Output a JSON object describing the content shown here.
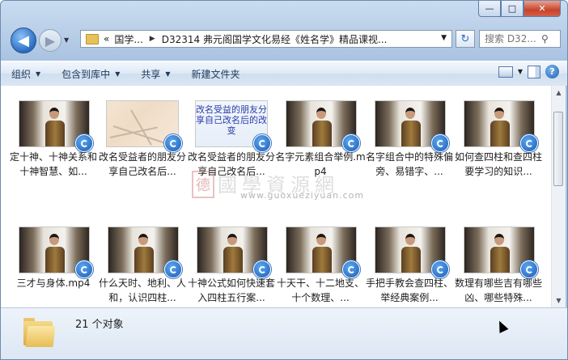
{
  "window": {
    "min": "—",
    "max": "□",
    "close": "✕"
  },
  "nav": {
    "back": "◀",
    "forward": "▶",
    "breadcrumb_prefix": "«",
    "crumbs": [
      "国学...",
      "D32314 弗元阁国学文化易经《姓名学》精品课视..."
    ],
    "search_placeholder": "搜索 D32...",
    "refresh": "↻"
  },
  "toolbar": {
    "organize": "组织",
    "include_library": "包含到库中",
    "share": "共享",
    "new_folder": "新建文件夹"
  },
  "items": [
    {
      "label": "定十神、十神关系和十神智慧、如...",
      "thumb": "video"
    },
    {
      "label": "改名受益者的朋友分享自己改名后...",
      "thumb": "map"
    },
    {
      "label": "改名受益者的朋友分享自己改名后...",
      "thumb": "text",
      "thumb_text": "改名受益的朋友分享自己改名后的改变"
    },
    {
      "label": "名字元素组合举例.mp4",
      "thumb": "video"
    },
    {
      "label": "名字组合中的特殊偏旁、易错字、...",
      "thumb": "video"
    },
    {
      "label": "如何查四柱和查四柱要学习的知识...",
      "thumb": "video"
    },
    {
      "label": "三才与身体.mp4",
      "thumb": "video"
    },
    {
      "label": "什么天时、地利、人和，认识四柱...",
      "thumb": "video"
    },
    {
      "label": "十神公式如何快速套入四柱五行案...",
      "thumb": "video"
    },
    {
      "label": "十天干、十二地支、十个数理、...",
      "thumb": "video"
    },
    {
      "label": "手把手教会查四柱、举经典案例...",
      "thumb": "video"
    },
    {
      "label": "数理有哪些吉有哪些凶、哪些特殊...",
      "thumb": "video"
    }
  ],
  "watermark": {
    "cn": "國學資源網",
    "url": "www.guoxueziyuan.com",
    "seal": "德"
  },
  "status": {
    "count": "21 个对象"
  }
}
